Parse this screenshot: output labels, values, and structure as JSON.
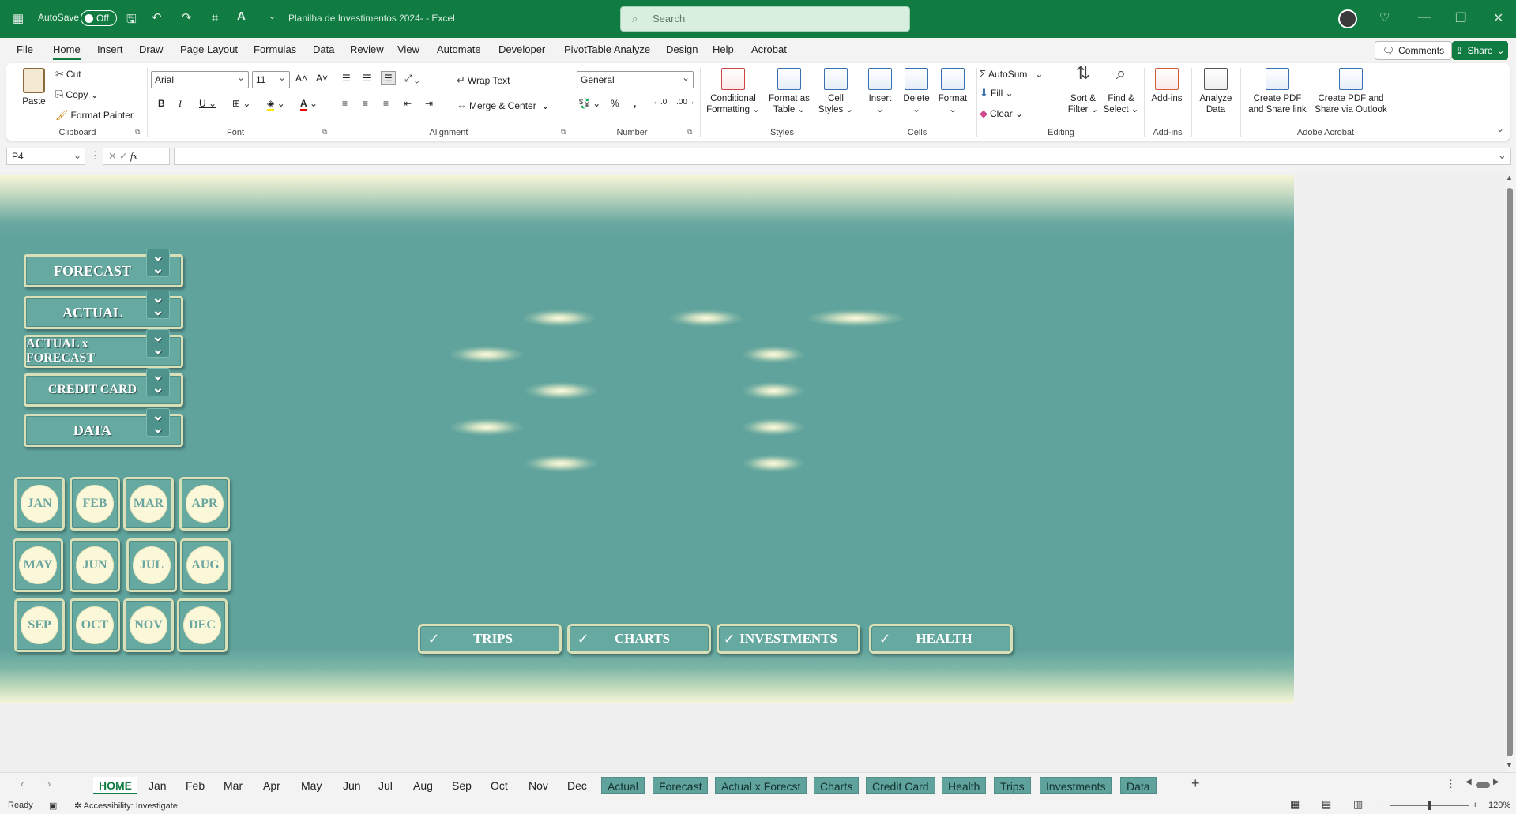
{
  "titlebar": {
    "autosave_label": "AutoSave",
    "autosave_state": "Off",
    "doc_title": "Planilha de Investimentos 2024-  -  Excel",
    "search_placeholder": "Search"
  },
  "menu": {
    "items": [
      "File",
      "Home",
      "Insert",
      "Draw",
      "Page Layout",
      "Formulas",
      "Data",
      "Review",
      "View",
      "Automate",
      "Developer",
      "PivotTable Analyze",
      "Design",
      "Help",
      "Acrobat"
    ],
    "active": "Home",
    "comments_label": "Comments",
    "share_label": "Share"
  },
  "ribbon": {
    "clipboard": {
      "paste": "Paste",
      "cut": "Cut",
      "copy": "Copy",
      "format_painter": "Format Painter",
      "label": "Clipboard"
    },
    "font": {
      "name": "Arial",
      "size": "11",
      "label": "Font"
    },
    "alignment": {
      "wrap_text": "Wrap Text",
      "merge_center": "Merge & Center",
      "label": "Alignment"
    },
    "number": {
      "format": "General",
      "label": "Number"
    },
    "styles": {
      "conditional_1": "Conditional",
      "conditional_2": "Formatting",
      "format_table_1": "Format as",
      "format_table_2": "Table",
      "cell_styles_1": "Cell",
      "cell_styles_2": "Styles",
      "label": "Styles"
    },
    "cells": {
      "insert": "Insert",
      "delete": "Delete",
      "format": "Format",
      "label": "Cells"
    },
    "editing": {
      "autosum": "AutoSum",
      "fill": "Fill",
      "clear": "Clear",
      "sort_1": "Sort &",
      "sort_2": "Filter",
      "find_1": "Find &",
      "find_2": "Select",
      "label": "Editing"
    },
    "addins": {
      "addins": "Add-ins",
      "label": "Add-ins"
    },
    "analyze": {
      "analyze_1": "Analyze",
      "analyze_2": "Data"
    },
    "acrobat": {
      "create_pdf_1": "Create PDF",
      "create_pdf_2": "and Share link",
      "share_outlook_1": "Create PDF and",
      "share_outlook_2": "Share via Outlook",
      "label": "Adobe Acrobat"
    }
  },
  "formula_bar": {
    "name_box": "P4",
    "fx": "fx"
  },
  "dashboard": {
    "nav_buttons": [
      "FORECAST",
      "ACTUAL",
      "ACTUAL x FORECAST",
      "CREDIT CARD",
      "DATA"
    ],
    "months": [
      "JAN",
      "FEB",
      "MAR",
      "APR",
      "MAY",
      "JUN",
      "JUL",
      "AUG",
      "SEP",
      "OCT",
      "NOV",
      "DEC"
    ],
    "categories": [
      "TRIPS",
      "CHARTS",
      "INVESTMENTS",
      "HEALTH"
    ]
  },
  "sheet_tabs": {
    "tabs": [
      "HOME",
      "Jan",
      "Feb",
      "Mar",
      "Apr",
      "May",
      "Jun",
      "Jul",
      "Aug",
      "Sep",
      "Oct",
      "Nov",
      "Dec",
      "Actual",
      "Forecast",
      "Actual x Forecst",
      "Charts",
      "Credit Card",
      "Health",
      "Trips",
      "Investments",
      "Data"
    ],
    "active": "HOME"
  },
  "status": {
    "ready": "Ready",
    "accessibility": "Accessibility: Investigate",
    "zoom": "120%"
  },
  "colors": {
    "excel_green": "#107c41",
    "dashboard_teal": "#5fa39c",
    "button_border": "#d9dfb6",
    "month_circle": "#fbf8da"
  }
}
